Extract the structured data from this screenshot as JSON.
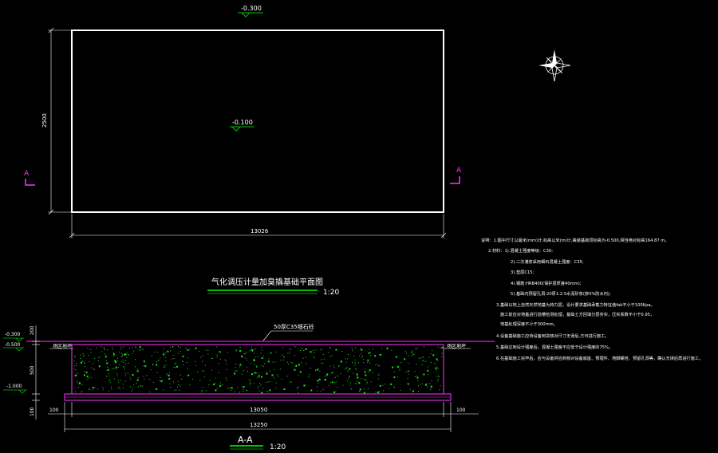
{
  "plan": {
    "top_level": "-0.300",
    "center_level": "-0.100",
    "width_dim": "13026",
    "height_dim": "2500",
    "section_mark_left": "A",
    "section_mark_right": "A",
    "title": "气化调压计量加臭撬基础平面图",
    "scale": "1:20"
  },
  "section": {
    "title": "A-A",
    "scale": "1:20",
    "cushion_label": "50厚C35细石砼",
    "ground_left": "场区地坪",
    "ground_right": "场区地坪",
    "level_top": "-0.300",
    "level_mid": "-0.500",
    "level_bottom": "-1.000",
    "dim_v_top": "200",
    "dim_v_mid": "500",
    "dim_v_bottom": "100",
    "dim_left_100": "100",
    "dim_right_100": "100",
    "dim_inner": "13050",
    "dim_outer": "13250"
  },
  "notes": {
    "lines": [
      "说明：1.图中尺寸以毫米(mm)计,标高以米(m)计,撬装基础顶标高为-0.500,相当绝对标高164.87 m。",
      "2.材料：1).混凝土强度等级：C30;",
      "2).二次灌浆采用细石混凝土强度：C35;",
      "3).垫层C15;",
      "4).钢筋:HRB400(保护层厚度40mm);",
      "5).基础内预留孔洞:20厚1:2.5水泥砂浆(掺5%防水剂);",
      "3.基础以地上自然天然地基为持力层，设计要求基础承载力特征值fak不小于100Kpa。",
      "施工前应对地基进行验槽检测处理，基础土方回填分层夯实，压实系数不小于0.95，",
      "地基处理深度不小于300mm。",
      "4.设备基础施工应待设备到货核对尺寸无误后,方可进行施工。",
      "5.基础达到设计强度后，混凝土强度不应低于设计强度的75%。",
      "6.在基础施工完毕后，应与设备供应商核对设备底座、预埋件、地脚螺栓、预留孔洞等，确认无误后再进行施工。"
    ]
  }
}
